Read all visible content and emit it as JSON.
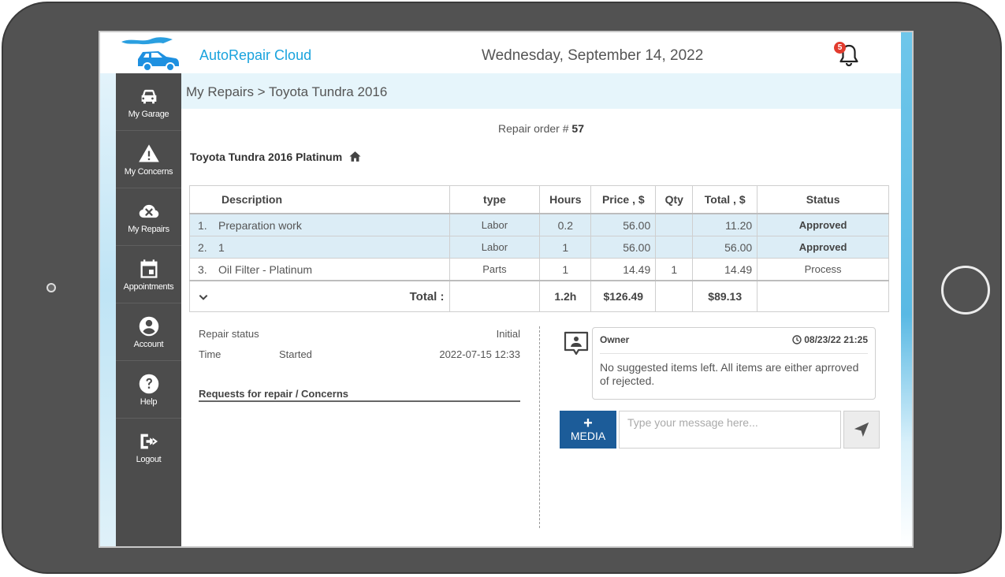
{
  "app": {
    "name": "AutoRepair Cloud",
    "date": "Wednesday, September 14, 2022",
    "notifications_count": "5"
  },
  "sidebar": {
    "items": [
      {
        "label": "My Garage",
        "icon": "car-icon"
      },
      {
        "label": "My Concerns",
        "icon": "warning-icon"
      },
      {
        "label": "My Repairs",
        "icon": "repair-cloud-icon"
      },
      {
        "label": "Appointments",
        "icon": "calendar-icon"
      },
      {
        "label": "Account",
        "icon": "account-icon"
      },
      {
        "label": "Help",
        "icon": "help-icon"
      },
      {
        "label": "Logout",
        "icon": "logout-icon"
      }
    ]
  },
  "breadcrumb": "My Repairs > Toyota Tundra 2016",
  "repair_order": {
    "label": "Repair order #",
    "number": "57"
  },
  "vehicle": {
    "title": "Toyota Tundra 2016 Platinum"
  },
  "table": {
    "headers": {
      "description": "Description",
      "type": "type",
      "hours": "Hours",
      "price": "Price , $",
      "qty": "Qty",
      "total": "Total , $",
      "status": "Status"
    },
    "rows": [
      {
        "index": "1.",
        "description": "Preparation work",
        "type": "Labor",
        "hours": "0.2",
        "price": "56.00",
        "qty": "",
        "total": "11.20",
        "status": "Approved"
      },
      {
        "index": "2.",
        "description": "1",
        "type": "Labor",
        "hours": "1",
        "price": "56.00",
        "qty": "",
        "total": "56.00",
        "status": "Approved"
      },
      {
        "index": "3.",
        "description": "Oil Filter - Platinum",
        "type": "Parts",
        "hours": "1",
        "price": "14.49",
        "qty": "1",
        "total": "14.49",
        "status": "Process"
      }
    ],
    "totals": {
      "label": "Total :",
      "hours": "1.2h",
      "price": "$126.49",
      "total": "$89.13"
    }
  },
  "repair_info": {
    "status_label": "Repair status",
    "status_value": "Initial",
    "time_label": "Time",
    "time_state": "Started",
    "time_value": "2022-07-15 12:33",
    "requests_label": "Requests for repair / Concerns"
  },
  "message": {
    "author": "Owner",
    "timestamp": "08/23/22 21:25",
    "text": "No suggested items left. All items are either aprroved of rejected."
  },
  "composer": {
    "media_label": "MEDIA",
    "plus": "+",
    "placeholder": "Type your message here..."
  },
  "colors": {
    "brand": "#1aa3dd",
    "sidebar": "#4c4c4c",
    "approved_row": "#dcedf6",
    "media_button": "#1c5c99",
    "badge": "#e23b2e"
  }
}
